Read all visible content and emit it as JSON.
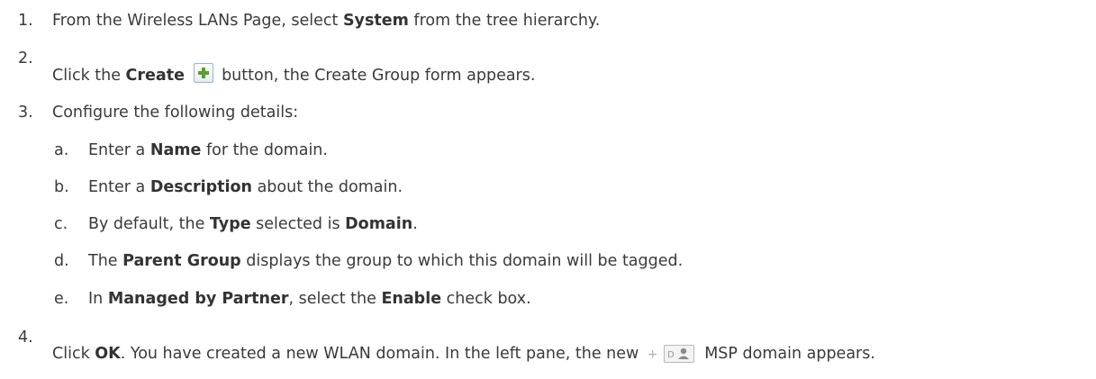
{
  "steps": [
    {
      "num": "1.",
      "pre": "From the Wireless LANs Page, select ",
      "bold": "System",
      "post": " from the tree hierarchy."
    },
    {
      "num": "2.",
      "pre": "Click the ",
      "bold": "Create",
      "post": " button, the Create Group form appears."
    },
    {
      "num": "3.",
      "text": "Configure the following details:"
    },
    {
      "num": "4.",
      "pre": "Click ",
      "bold": "OK",
      "mid": ". You have created a new WLAN domain. In the left pane, the new ",
      "post": " MSP domain appears."
    }
  ],
  "substeps": [
    {
      "letter": "a.",
      "pre": "Enter a ",
      "bold": "Name",
      "post": " for the domain."
    },
    {
      "letter": "b.",
      "pre": "Enter a ",
      "bold": "Description",
      "post": " about the domain."
    },
    {
      "letter": "c.",
      "pre": "By default, the ",
      "bold": "Type",
      "mid": " selected is ",
      "bold2": "Domain",
      "post": "."
    },
    {
      "letter": "d.",
      "pre": "The ",
      "bold": "Parent Group",
      "post": " displays the group to which this domain will be tagged."
    },
    {
      "letter": "e.",
      "pre": "In ",
      "bold": "Managed by Partner",
      "mid": ", select the ",
      "bold2": "Enable",
      "post": " check box."
    }
  ],
  "icons": {
    "create": "plus-icon",
    "msp_domain": "domain-user-icon",
    "plus_color": "#5aa02c"
  }
}
